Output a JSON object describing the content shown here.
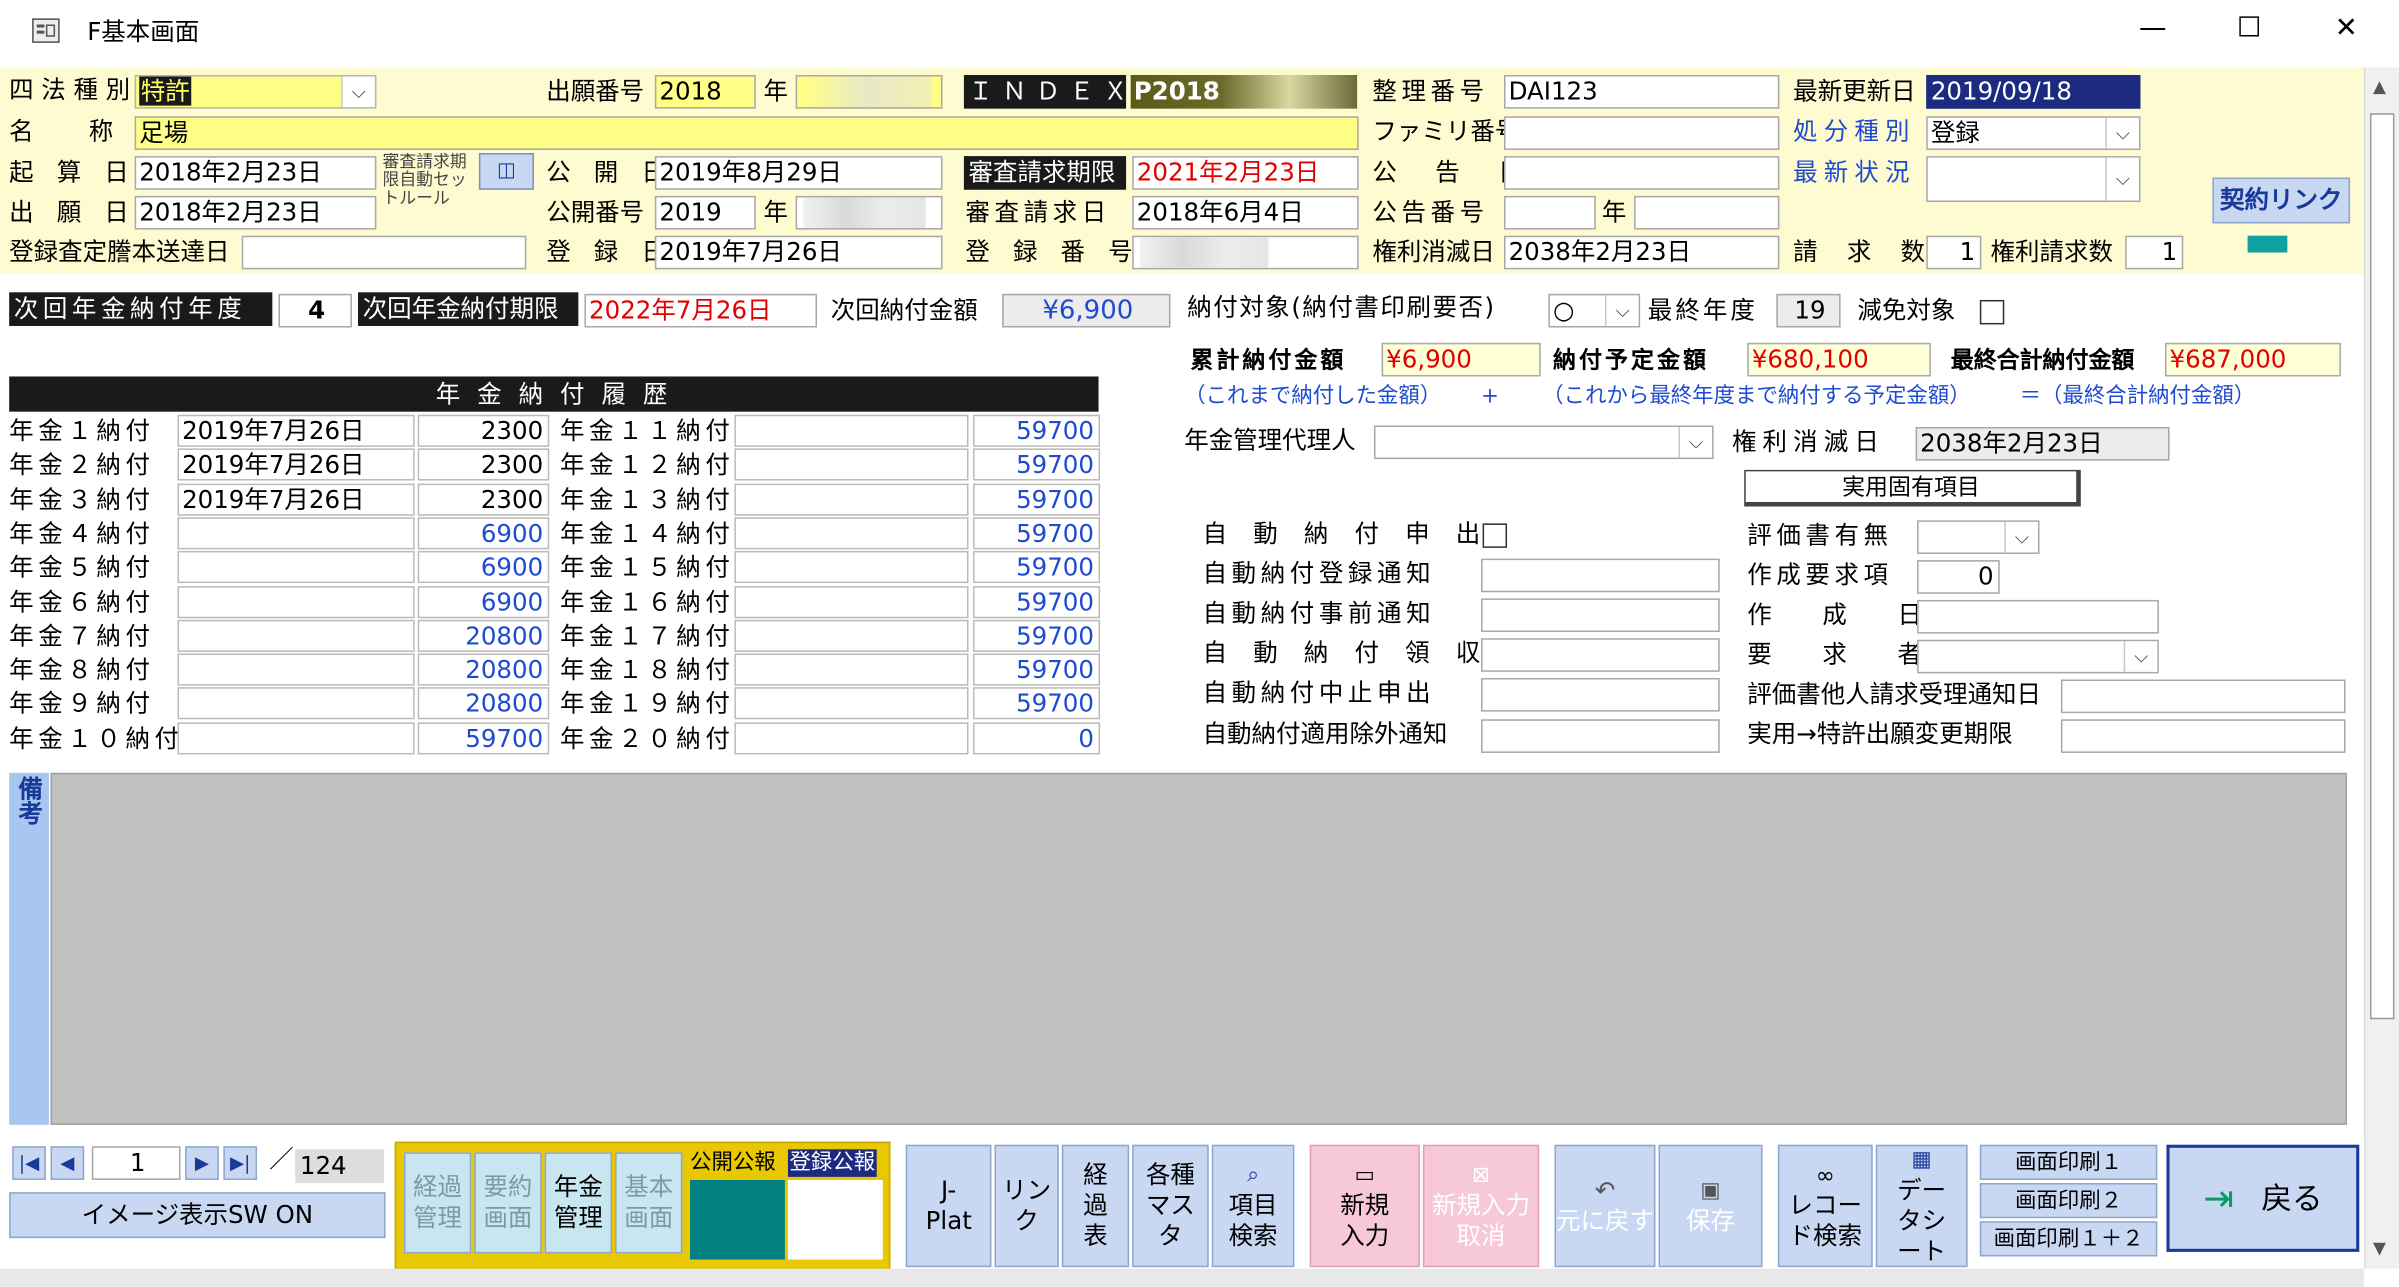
{
  "window": {
    "title": "F基本画面",
    "minimize": "—",
    "maximize": "☐",
    "close": "✕"
  },
  "colors": {
    "header_bg": "#fffbd0",
    "selected_fill": "#ffff88",
    "title_date_bg": "#1c2a80",
    "memo_bg": "#c0c0c0",
    "teal": "#008080",
    "pink_btn": "#f7c8d8",
    "blue_btn": "#c9d8f2"
  },
  "header": {
    "l_shiho": "四法種別",
    "v_shiho": "特許",
    "l_mei": "名　称",
    "v_mei": "足場",
    "l_kisan": "起 算 日",
    "v_kisan": "2018年2月23日",
    "l_shutsugan_bi": "出 願 日",
    "v_shutsugan_bi": "2018年2月23日",
    "l_toroku_satei": "登録査定謄本送達日",
    "v_toroku_satei": "",
    "l_shinsa_auto": "審査請求期限自動セットルール",
    "l_shutsugan_no": "出願番号",
    "v_shutsugan_no": "2018",
    "l_nen": "年",
    "l_koukai_bi": "公 開 日",
    "v_koukai_bi": "2019年8月29日",
    "l_koukai_no": "公開番号",
    "v_koukai_no": "2019",
    "l_nen2": "年",
    "l_toroku_bi": "登 録 日",
    "v_toroku_bi": "2019年7月26日",
    "l_index": "ＩＮＤＥＸ",
    "v_index": "P2018",
    "l_shinsa_kigen": "審査請求期限",
    "v_shinsa_kigen": "2021年2月23日",
    "l_shinsa_bi": "審査請求日",
    "v_shinsa_bi": "2018年6月4日",
    "l_toroku_no": "登 録 番 号",
    "l_seiri": "整理番号",
    "v_seiri": "DAI123",
    "l_family": "ファミリ番号",
    "v_family": "",
    "l_kokoku_bi": "公 告 日",
    "v_kokoku_bi": "",
    "l_kokoku_no": "公告番号",
    "v_kokoku_no": "",
    "l_nen3": "年",
    "v_kokoku_no2": "",
    "l_kenri_shometsu": "権利消滅日",
    "v_kenri_shometsu": "2038年2月23日",
    "l_saishin_koshin": "最新更新日",
    "v_saishin_koshin": "2019/09/18",
    "l_shobun": "処分種別",
    "v_shobun": "登録",
    "l_saishin_jokyo": "最新状況",
    "v_saishin_jokyo": "",
    "l_seikyu_su": "請 求 数",
    "v_seikyu_su": "1",
    "l_kenri_seikyu_su": "権利請求数",
    "v_kenri_seikyu_su": "1",
    "keiyaku_link": "契約リンク"
  },
  "nenkin": {
    "l_next_year": "次回年金納付年度",
    "v_next_year": "4",
    "l_next_kigen": "次回年金納付期限",
    "v_next_kigen": "2022年7月26日",
    "l_next_amount": "次回納付金額",
    "v_next_amount": "¥6,900",
    "l_target": "納付対象(納付書印刷要否)",
    "v_target": "○",
    "l_final_year": "最終年度",
    "v_final_year": "19",
    "l_genmen": "減免対象",
    "l_ruikei": "累計納付金額",
    "v_ruikei": "¥6,900",
    "l_yotei": "納付予定金額",
    "v_yotei": "¥680,100",
    "l_saishu_gokei": "最終合計納付金額",
    "v_saishu_gokei": "¥687,000",
    "note_ruikei": "（これまで納付した金額）",
    "plus": "+",
    "note_yotei": "（これから最終年度まで納付する予定金額）",
    "note_gokei": "＝（最終合計納付金額）",
    "l_dairinin": "年金管理代理人",
    "v_dairinin": "",
    "l_kenri_shometsu2": "権利消滅日",
    "v_kenri_shometsu2": "2038年2月23日",
    "jitsuyo_btn": "実用固有項目"
  },
  "history": {
    "title": "年 金 納 付 履 歴",
    "left": [
      {
        "label": "年金１納付",
        "date": "2019年7月26日",
        "amount": "2300"
      },
      {
        "label": "年金２納付",
        "date": "2019年7月26日",
        "amount": "2300"
      },
      {
        "label": "年金３納付",
        "date": "2019年7月26日",
        "amount": "2300"
      },
      {
        "label": "年金４納付",
        "date": "",
        "amount": "6900"
      },
      {
        "label": "年金５納付",
        "date": "",
        "amount": "6900"
      },
      {
        "label": "年金６納付",
        "date": "",
        "amount": "6900"
      },
      {
        "label": "年金７納付",
        "date": "",
        "amount": "20800"
      },
      {
        "label": "年金８納付",
        "date": "",
        "amount": "20800"
      },
      {
        "label": "年金９納付",
        "date": "",
        "amount": "20800"
      },
      {
        "label": "年金１０納付",
        "date": "",
        "amount": "59700"
      }
    ],
    "right": [
      {
        "label": "年金１１納付",
        "date": "",
        "amount": "59700"
      },
      {
        "label": "年金１２納付",
        "date": "",
        "amount": "59700"
      },
      {
        "label": "年金１３納付",
        "date": "",
        "amount": "59700"
      },
      {
        "label": "年金１４納付",
        "date": "",
        "amount": "59700"
      },
      {
        "label": "年金１５納付",
        "date": "",
        "amount": "59700"
      },
      {
        "label": "年金１６納付",
        "date": "",
        "amount": "59700"
      },
      {
        "label": "年金１７納付",
        "date": "",
        "amount": "59700"
      },
      {
        "label": "年金１８納付",
        "date": "",
        "amount": "59700"
      },
      {
        "label": "年金１９納付",
        "date": "",
        "amount": "59700"
      },
      {
        "label": "年金２０納付",
        "date": "",
        "amount": "0"
      }
    ]
  },
  "auto": {
    "l_moshide": "自 動 納 付 申 出",
    "l_toroku_tsuchi": "自動納付登録通知",
    "v_toroku_tsuchi": "",
    "l_jizen_tsuchi": "自動納付事前通知",
    "v_jizen_tsuchi": "",
    "l_ryoshu": "自 動 納 付 領 収",
    "v_ryoshu": "",
    "l_chushi": "自動納付中止申出",
    "v_chushi": "",
    "l_jogai": "自動納付適用除外通知",
    "v_jogai": "",
    "l_hyokasho": "評価書有無",
    "v_hyokasho": "",
    "l_sakusei_yokyu": "作成要求項",
    "v_sakusei_yokyu": "0",
    "l_sakuseibi": "作 成 日",
    "v_sakuseibi": "",
    "l_yokyusha": "要 求 者",
    "v_yokyusha": "",
    "l_tanin": "評価書他人請求受理通知日",
    "v_tanin": "",
    "l_henko": "実用→特許出願変更期限",
    "v_henko": ""
  },
  "memo": {
    "label": "備考",
    "text": ""
  },
  "footer": {
    "record_current": "1",
    "record_sep": "／",
    "record_total": "124",
    "image_sw": "イメージ表示SW ON",
    "btn_keika": "経過管理",
    "btn_yoyaku": "要約画面",
    "btn_nenkin": "年金管理",
    "btn_kihon": "基本画面",
    "l_koukai_koho": "公開公報",
    "l_toroku_koho": "登録公報",
    "btn_jplat": "J-Plat",
    "btn_link": "リンク",
    "btn_keikahyo": "経過表",
    "btn_master": "各種マスタ",
    "btn_kensaku": "項目検索",
    "btn_new": "新規入力",
    "btn_new_cancel": "新規入力取消",
    "btn_undo": "元に戻す",
    "btn_save": "保存",
    "btn_rec_search": "レコード検索",
    "btn_datasheet": "データシート",
    "btn_print1": "画面印刷１",
    "btn_print2": "画面印刷２",
    "btn_print12": "画面印刷１＋２",
    "btn_back": "戻る"
  }
}
